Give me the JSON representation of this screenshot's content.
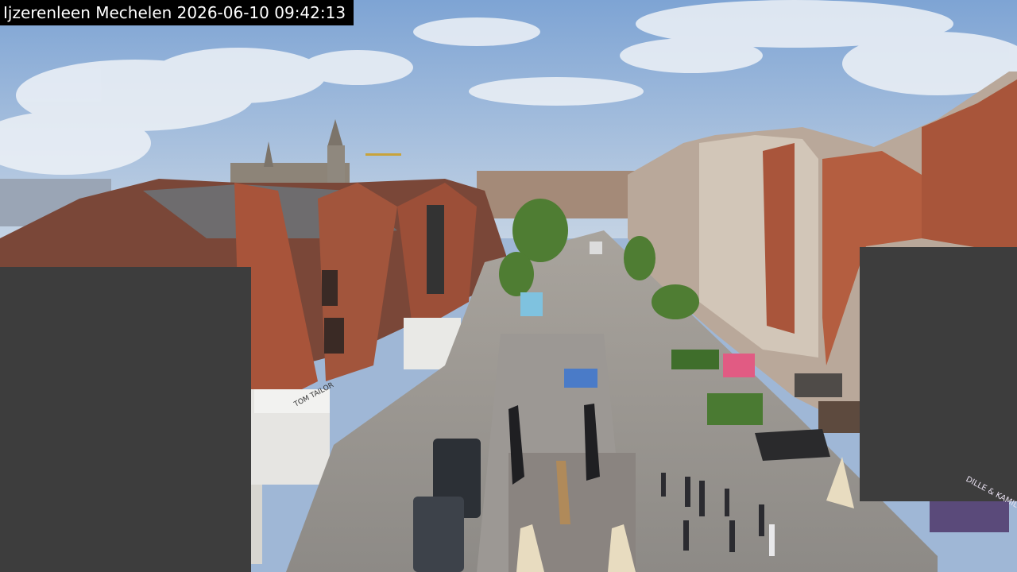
{
  "webcam": {
    "caption": "Ijzerenleen Mechelen 2026-06-10 09:42:13"
  },
  "shop_signs": {
    "left_building": "TOM TAILOR",
    "right_awning": "DILLE & KAMILLE"
  },
  "colors": {
    "sky": "#8fb0d8",
    "brick": "#a8543a",
    "pavement": "#b9b2a8",
    "privacy_mask": "#3d3d3d",
    "trees": "#4f7d33"
  }
}
